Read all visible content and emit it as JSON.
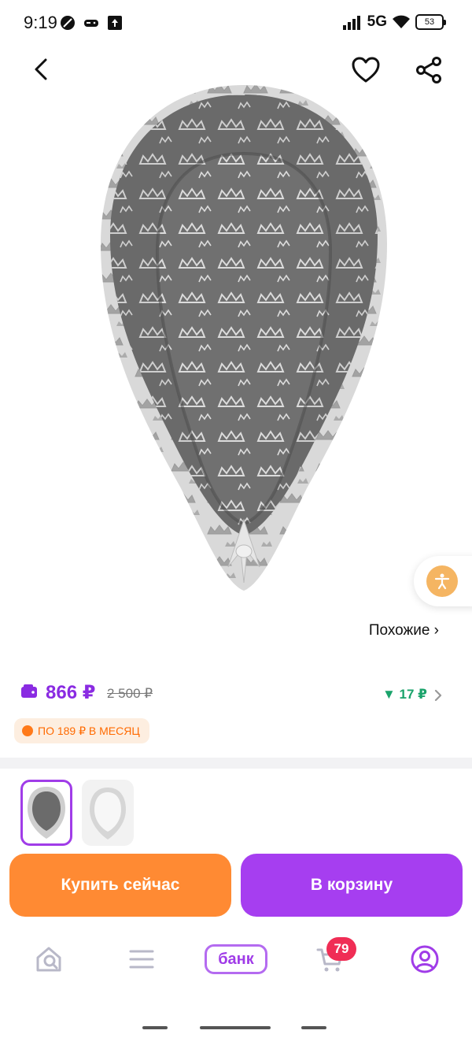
{
  "status_bar": {
    "time": "9:19",
    "network": "5G",
    "battery": "53"
  },
  "product": {
    "similar_link": "Похожие ›"
  },
  "price": {
    "current": "866 ₽",
    "old": "2 500 ₽",
    "bonus": "▼ 17 ₽",
    "installment": "ПО 189 ₽ В МЕСЯЦ"
  },
  "actions": {
    "buy_now": "Купить сейчас",
    "add_to_cart": "В корзину"
  },
  "bottom_nav": {
    "bank_label": "банк",
    "cart_count": "79"
  },
  "colors": {
    "accent_purple": "#a63ef0",
    "accent_orange": "#ff8a33",
    "bonus_green": "#1aa36b",
    "badge_red": "#f02d55"
  },
  "icons": [
    "back-arrow-icon",
    "heart-icon",
    "share-icon",
    "accessibility-icon",
    "wallet-icon",
    "chevron-right-icon",
    "home-search-icon",
    "catalog-icon",
    "cart-icon",
    "profile-icon"
  ]
}
